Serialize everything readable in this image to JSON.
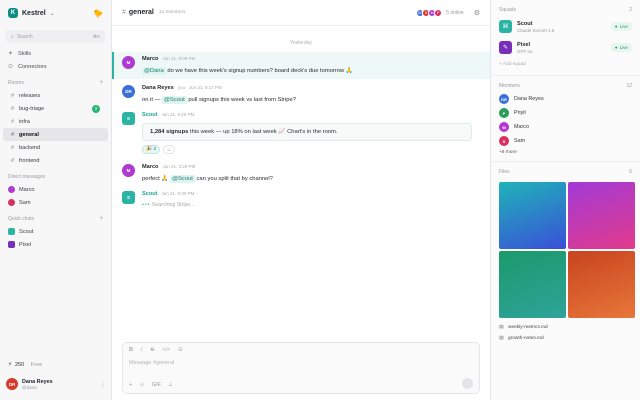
{
  "workspace": {
    "logo_letter": "K",
    "name": "Kestrel"
  },
  "left": {
    "search_placeholder": "Search",
    "search_shortcut": "⌘K",
    "nav": [
      {
        "label": "Skills",
        "icon": "sparkle-icon"
      },
      {
        "label": "Connectors",
        "icon": "plug-icon"
      }
    ],
    "rooms_title": "Rooms",
    "rooms": [
      {
        "label": "releases"
      },
      {
        "label": "bug-triage",
        "badge": "2"
      },
      {
        "label": "infra"
      },
      {
        "label": "general",
        "active": true
      },
      {
        "label": "backend"
      },
      {
        "label": "frontend"
      }
    ],
    "dm_title": "Direct messages",
    "dms": [
      {
        "label": "Marco",
        "color": "#b03ad1"
      },
      {
        "label": "Sam",
        "color": "#d8305f"
      }
    ],
    "quick_title": "Quick chats",
    "quick": [
      {
        "label": "Scout",
        "color": "#2bb3a3"
      },
      {
        "label": "Pixel",
        "color": "#7a2fb8"
      }
    ],
    "credits": "250",
    "plan": "· Free",
    "user": {
      "initials": "DR",
      "name": "Dana Reyes",
      "handle": "@dana"
    }
  },
  "channel": {
    "name": "general",
    "count": "12 members",
    "online": "5 online",
    "day": "Yesterday",
    "messages": [
      {
        "author": "Marco",
        "initials": "M",
        "color": "#b03ad1",
        "time": "Jun 21, 9:09 PM",
        "pre": "",
        "mention": "@Dana",
        "post": " do we have this week's signup numbers? board deck's due tomorrow 🙏",
        "highlight": true
      },
      {
        "author": "Dana Reyes",
        "initials": "DR",
        "color": "#3a6fd8",
        "time": "you · Jun 21, 9:17 PM",
        "pre": "on it — ",
        "mention": "@Scout",
        "post": " pull signups this week vs last from Stripe?"
      },
      {
        "author": "Scout",
        "initials": "S",
        "color": "#2bb3a3",
        "time": "Jun 21, 9:26 PM",
        "bot": true,
        "card_bold": "1,284 signups",
        "card_rest": " this week — up 18% on last week 📈 Chart's in the room.",
        "reaction": "🎉 3"
      },
      {
        "author": "Marco",
        "initials": "M",
        "color": "#b03ad1",
        "time": "Jun 21, 3:29 PM",
        "pre": "perfect 🙏 ",
        "mention": "@Scout",
        "post": " can you split that by channel?"
      },
      {
        "author": "Scout",
        "initials": "S",
        "color": "#2bb3a3",
        "time": "Jun 21, 9:30 PM",
        "bot": true,
        "typing": "Searching Stripe..."
      }
    ],
    "composer_placeholder": "Message #general",
    "format_icons": [
      "B",
      "I",
      "S",
      "</>",
      "⊟"
    ],
    "tool_icons": [
      "+",
      "☺",
      "GIF",
      "⊥"
    ]
  },
  "right": {
    "squads_title": "Squads",
    "squads_count": "2",
    "squads": [
      {
        "name": "Scout",
        "sub": "Claude Sonnet 4.5",
        "status": "Live",
        "color": "#2bb3a3",
        "icon": "robot-icon"
      },
      {
        "name": "Pixel",
        "sub": "GPT-4o",
        "status": "Live",
        "color": "#7a2fb8",
        "icon": "palette-icon"
      }
    ],
    "add_agent": "+ Add squad",
    "members_title": "Members",
    "members_count": "12",
    "members": [
      {
        "initials": "DR",
        "name": "Dana Reyes",
        "color": "#3a6fd8"
      },
      {
        "initials": "P",
        "name": "Priyil",
        "color": "#2b9c5c"
      },
      {
        "initials": "M",
        "name": "Marco",
        "color": "#b03ad1"
      },
      {
        "initials": "S",
        "name": "Sam",
        "color": "#d8305f"
      }
    ],
    "more": "+8 more",
    "files_title": "Files",
    "files_count": "6",
    "thumbs": [
      {
        "from": "#1fb4b8",
        "to": "#3a4fd8"
      },
      {
        "from": "#a23ad8",
        "to": "#e23a8a"
      },
      {
        "from": "#1a9a6b",
        "to": "#2fa39a"
      },
      {
        "from": "#c8441f",
        "to": "#e8763a"
      }
    ],
    "files": [
      {
        "name": "weekly-metrics.md"
      },
      {
        "name": "growth-notes.md"
      }
    ]
  }
}
